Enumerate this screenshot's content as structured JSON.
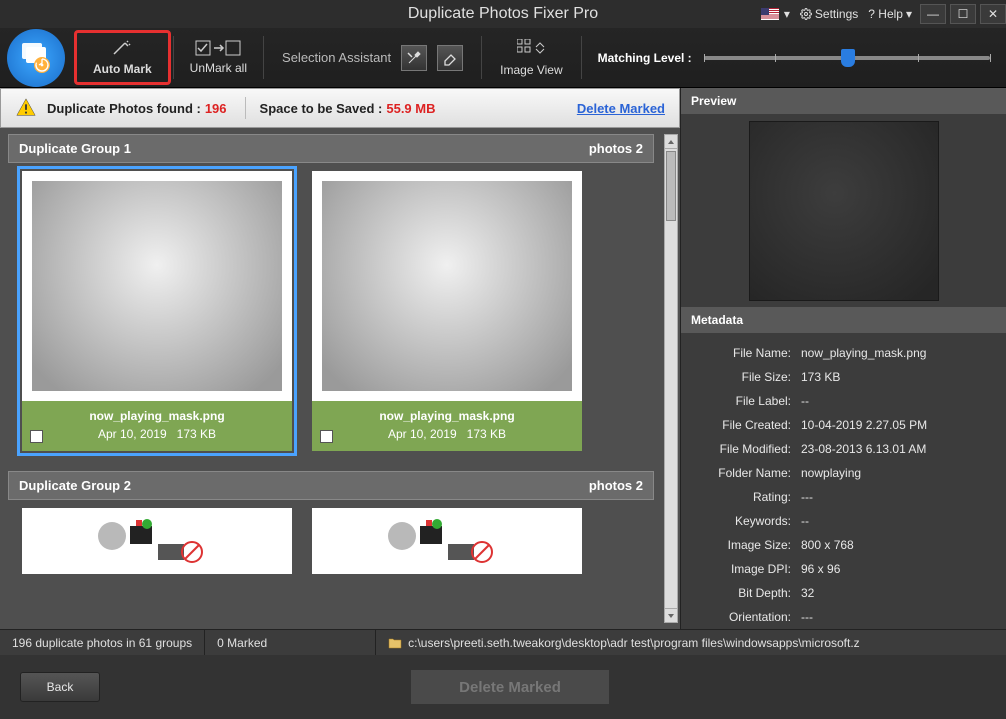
{
  "title": "Duplicate Photos Fixer Pro",
  "titlebar": {
    "settings": "Settings",
    "help": "? Help"
  },
  "toolbar": {
    "auto_mark": "Auto Mark",
    "unmark_all": "UnMark all",
    "selection_assistant": "Selection Assistant",
    "image_view": "Image View",
    "matching_level": "Matching Level :"
  },
  "info": {
    "found_label": "Duplicate Photos found :",
    "found_count": "196",
    "space_label": "Space to be Saved :",
    "space_value": "55.9 MB",
    "delete_marked": "Delete Marked"
  },
  "groups": [
    {
      "title": "Duplicate Group 1",
      "count_label": "photos 2",
      "photos": [
        {
          "filename": "now_playing_mask.png",
          "date": "Apr 10, 2019",
          "size": "173 KB",
          "selected": true
        },
        {
          "filename": "now_playing_mask.png",
          "date": "Apr 10, 2019",
          "size": "173 KB",
          "selected": false
        }
      ]
    },
    {
      "title": "Duplicate Group 2",
      "count_label": "photos 2"
    }
  ],
  "side": {
    "preview_label": "Preview",
    "metadata_label": "Metadata",
    "rows": [
      {
        "label": "File Name:",
        "value": "now_playing_mask.png"
      },
      {
        "label": "File Size:",
        "value": "173 KB"
      },
      {
        "label": "File Label:",
        "value": "--"
      },
      {
        "label": "File Created:",
        "value": "10-04-2019 2.27.05 PM"
      },
      {
        "label": "File Modified:",
        "value": "23-08-2013 6.13.01 AM"
      },
      {
        "label": "Folder Name:",
        "value": "nowplaying"
      },
      {
        "label": "Rating:",
        "value": "---"
      },
      {
        "label": "Keywords:",
        "value": "--"
      },
      {
        "label": "Image Size:",
        "value": "800 x 768"
      },
      {
        "label": "Image DPI:",
        "value": "96 x 96"
      },
      {
        "label": "Bit Depth:",
        "value": "32"
      },
      {
        "label": "Orientation:",
        "value": "---"
      }
    ]
  },
  "status": {
    "summary": "196 duplicate photos in 61 groups",
    "marked": "0 Marked",
    "path": "c:\\users\\preeti.seth.tweakorg\\desktop\\adr test\\program files\\windowsapps\\microsoft.z"
  },
  "actions": {
    "back": "Back",
    "delete_marked": "Delete Marked"
  }
}
